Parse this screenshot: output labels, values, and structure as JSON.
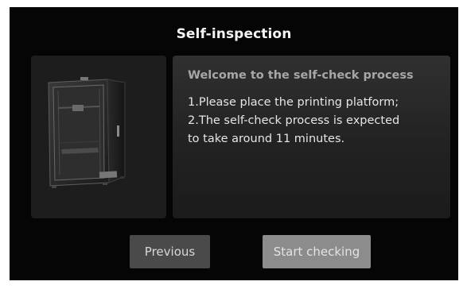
{
  "dialog": {
    "title": "Self-inspection"
  },
  "panel": {
    "heading": "Welcome to the self-check process",
    "lines": [
      "1.Please place the printing platform;",
      "2.The self-check process is expected",
      "to take around 11 minutes."
    ]
  },
  "buttons": {
    "previous_label": "Previous",
    "start_label": "Start checking"
  },
  "colors": {
    "screen_background": "#050505",
    "panel_background": "#262626",
    "previous_button": "#4a4a4a",
    "start_button": "#8c8c8c"
  },
  "illustration": {
    "icon": "3d-printer-image"
  }
}
